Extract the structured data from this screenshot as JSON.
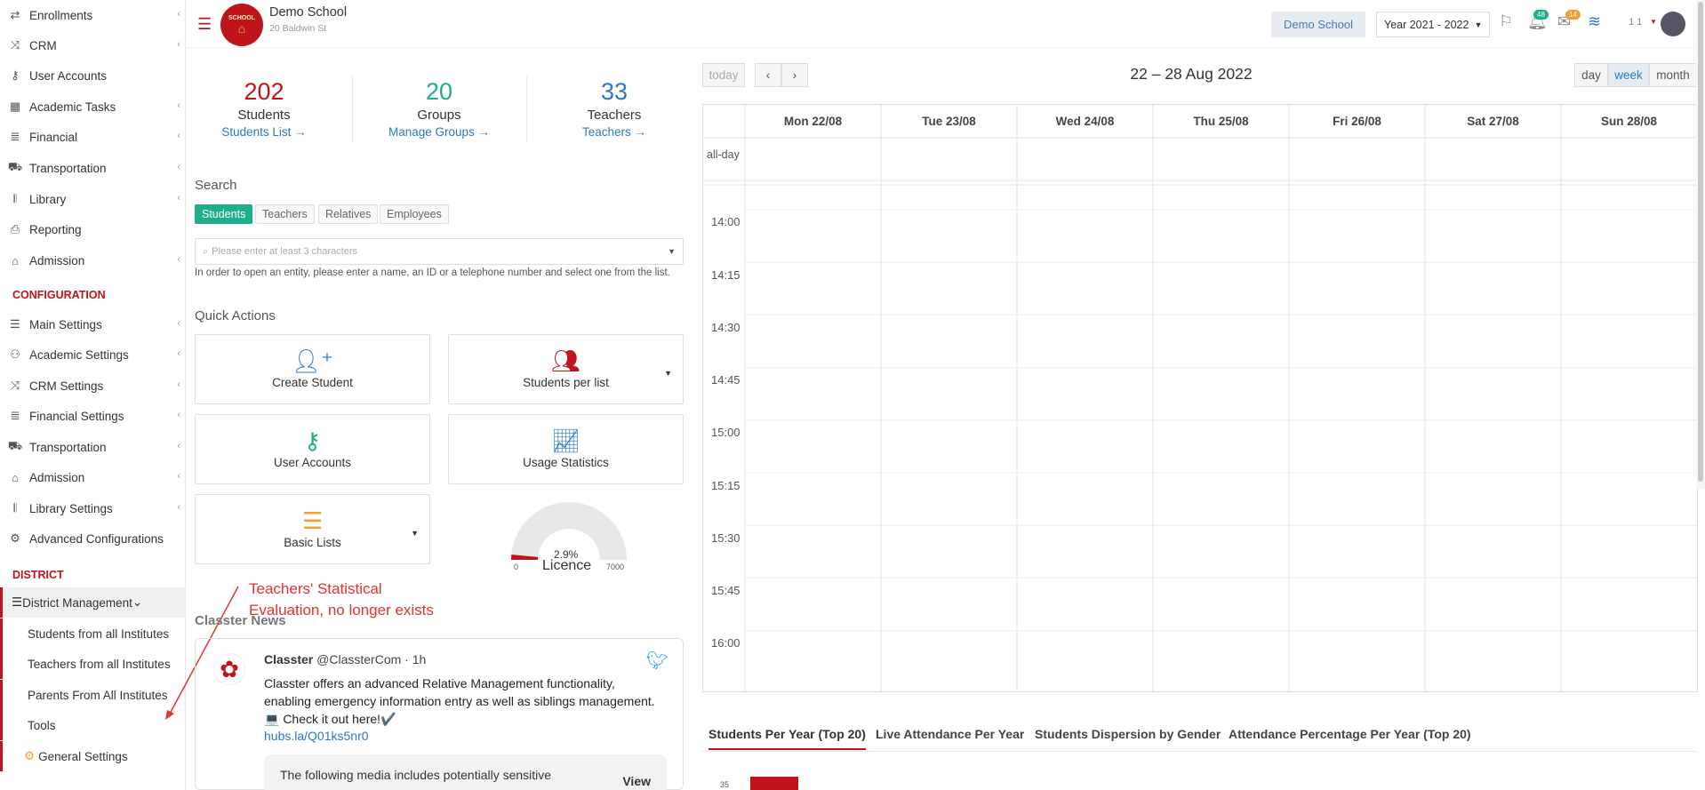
{
  "sidebar": {
    "items": [
      {
        "label": "Enrollments",
        "icon": "exchange-icon",
        "chev": true
      },
      {
        "label": "CRM",
        "icon": "shuffle-icon",
        "chev": true
      },
      {
        "label": "User Accounts",
        "icon": "key-icon",
        "chev": false
      },
      {
        "label": "Academic Tasks",
        "icon": "grid-icon",
        "chev": true
      },
      {
        "label": "Financial",
        "icon": "coins-icon",
        "chev": true
      },
      {
        "label": "Transportation",
        "icon": "bus-icon",
        "chev": true
      },
      {
        "label": "Library",
        "icon": "books-icon",
        "chev": true
      },
      {
        "label": "Reporting",
        "icon": "printer-icon",
        "chev": false
      },
      {
        "label": "Admission",
        "icon": "building-icon",
        "chev": true
      }
    ],
    "config_header": "CONFIGURATION",
    "config_items": [
      {
        "label": "Main Settings",
        "icon": "sliders-icon",
        "chev": true
      },
      {
        "label": "Academic Settings",
        "icon": "users-icon",
        "chev": true
      },
      {
        "label": "CRM Settings",
        "icon": "shuffle-icon",
        "chev": true
      },
      {
        "label": "Financial Settings",
        "icon": "coins-icon",
        "chev": true
      },
      {
        "label": "Transportation",
        "icon": "bus-icon",
        "chev": true
      },
      {
        "label": "Admission",
        "icon": "building-icon",
        "chev": true
      },
      {
        "label": "Library Settings",
        "icon": "books-icon",
        "chev": true
      },
      {
        "label": "Advanced Configurations",
        "icon": "gears-icon",
        "chev": false
      }
    ],
    "district_header": "DISTRICT",
    "district_management": "District Management",
    "district_items": [
      "Students from all Institutes",
      "Teachers from all Institutes",
      "Parents From All Institutes",
      "Tools",
      "General Settings"
    ]
  },
  "header": {
    "logo_text": "SCHOOL",
    "school_name": "Demo School",
    "school_address": "20 Baldwin St",
    "school_button": "Demo School",
    "year_select": "Year 2021 - 2022",
    "notif_badge": "48",
    "mail_badge": "14",
    "user_short": "1 1"
  },
  "stats": [
    {
      "num": "202",
      "label": "Students",
      "link": "Students List",
      "color": "#c0141c"
    },
    {
      "num": "20",
      "label": "Groups",
      "link": "Manage Groups",
      "color": "#1fae8a"
    },
    {
      "num": "33",
      "label": "Teachers",
      "link": "Teachers",
      "color": "#2a7ac0"
    }
  ],
  "search": {
    "title": "Search",
    "tabs": [
      "Students",
      "Teachers",
      "Relatives",
      "Employees"
    ],
    "placeholder": "Please enter at least 3 characters",
    "help": "In order to open an entity, please enter a name, an ID or a telephone number and select one from the list."
  },
  "quick_actions": {
    "title": "Quick Actions",
    "items": [
      "Create Student",
      "Students per list",
      "User Accounts",
      "Usage Statistics",
      "Basic Lists"
    ]
  },
  "gauge": {
    "percent": "2.9%",
    "value_fraction": 0.029,
    "min": "0",
    "max": "7000",
    "label": "Licence"
  },
  "annotation": [
    "Teachers' Statistical",
    "Evaluation, no longer exists"
  ],
  "news": {
    "title": "Classter News",
    "author": "Classter",
    "handle": "@ClassterCom · 1h",
    "text": "Classter offers an advanced Relative Management functionality, enabling emergency information entry as well as siblings management.💻 Check it out here!✔️",
    "link": "hubs.la/Q01ks5nr0",
    "sensitive": "The following media includes potentially sensitive",
    "view": "View"
  },
  "calendar": {
    "today": "today",
    "title": "22 – 28 Aug 2022",
    "views": [
      "day",
      "week",
      "month"
    ],
    "active_view": "week",
    "all_day": "all-day",
    "days": [
      "Mon 22/08",
      "Tue 23/08",
      "Wed 24/08",
      "Thu 25/08",
      "Fri 26/08",
      "Sat 27/08",
      "Sun 28/08"
    ],
    "times": [
      "14:00",
      "14:15",
      "14:30",
      "14:45",
      "15:00",
      "15:15",
      "15:30",
      "15:45",
      "16:00"
    ]
  },
  "chart_tabs": [
    "Students Per Year (Top 20)",
    "Live Attendance Per Year",
    "Students Dispersion by Gender",
    "Attendance Percentage Per Year (Top 20)"
  ],
  "chart_tick": "35"
}
